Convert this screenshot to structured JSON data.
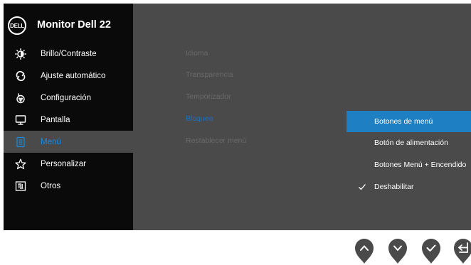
{
  "header": {
    "logo_text": "DELL",
    "title": "Monitor Dell 22"
  },
  "menu": {
    "items": [
      {
        "label": "Brillo/Contraste",
        "icon": "brightness-icon"
      },
      {
        "label": "Ajuste automático",
        "icon": "auto-adjust-icon"
      },
      {
        "label": "Configuración",
        "icon": "input-source-icon"
      },
      {
        "label": "Pantalla",
        "icon": "display-icon"
      },
      {
        "label": "Menú",
        "icon": "menu-icon",
        "active": true
      },
      {
        "label": "Personalizar",
        "icon": "star-icon"
      },
      {
        "label": "Otros",
        "icon": "others-icon"
      }
    ]
  },
  "submenu": {
    "items": [
      {
        "label": "Idioma"
      },
      {
        "label": "Transparencia"
      },
      {
        "label": "Temporizador"
      },
      {
        "label": "Bloqueo",
        "active": true
      },
      {
        "label": "Restablecer menú"
      }
    ]
  },
  "lock_options": {
    "items": [
      {
        "label": "Botones de menú",
        "highlighted": true
      },
      {
        "label": "Botón de alimentación"
      },
      {
        "label": "Botones Menú + Encendido"
      },
      {
        "label": "Deshabilitar",
        "checked": true
      }
    ]
  },
  "hardware_buttons": [
    "up-icon",
    "down-icon",
    "check-icon",
    "exit-icon"
  ],
  "colors": {
    "accent": "#1e7fc2",
    "sidebar_bg": "#0a0a0a",
    "panel_bg": "#4a4a4a",
    "button_bg": "#4a4a4a"
  }
}
